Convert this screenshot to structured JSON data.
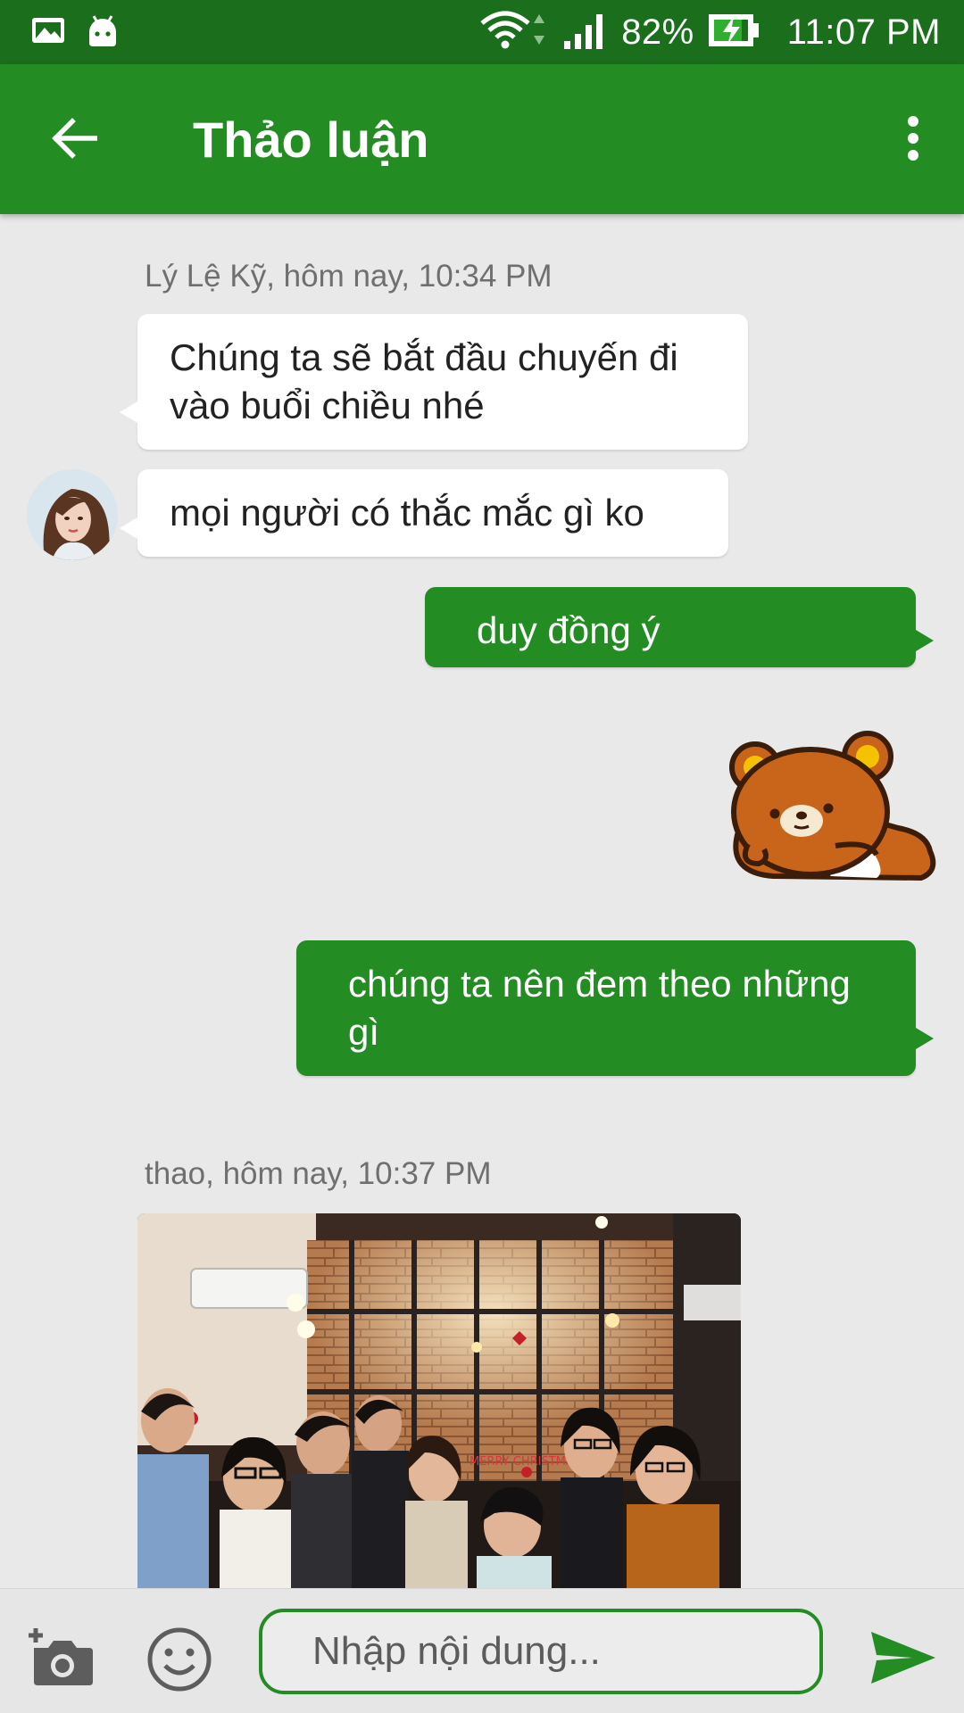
{
  "status_bar": {
    "battery": "82%",
    "time": "11:07 PM",
    "icons": [
      "gallery-notification-icon",
      "android-notification-icon",
      "wifi-icon",
      "cell-signal-icon",
      "battery-charging-icon"
    ]
  },
  "app_bar": {
    "title": "Thảo luận",
    "back_icon": "arrow-left-icon",
    "menu_icon": "more-vertical-icon"
  },
  "colors": {
    "status_bar": "#1b6e1b",
    "primary": "#238c23",
    "background": "#e9e9e9",
    "incoming_bubble": "#ffffff"
  },
  "messages": {
    "group1_meta": "Lý Lệ Kỹ, hôm nay, 10:34 PM",
    "in1": "Chúng ta sẽ bắt đầu chuyến đi vào buổi chiều nhé",
    "in2": "mọi người có thắc mắc gì ko",
    "out1": "duy đồng ý",
    "sticker": "brown-bear-sticker",
    "out2": "chúng ta nên đem theo những gì",
    "group2_meta": "thao, hôm nay, 10:37 PM",
    "photo": "group-photo",
    "photo_sign": "MERRY CHRISTMAS"
  },
  "composer": {
    "placeholder": "Nhập nội dung...",
    "camera_icon": "camera-add-icon",
    "emoji_icon": "emoji-icon",
    "send_icon": "send-icon"
  }
}
